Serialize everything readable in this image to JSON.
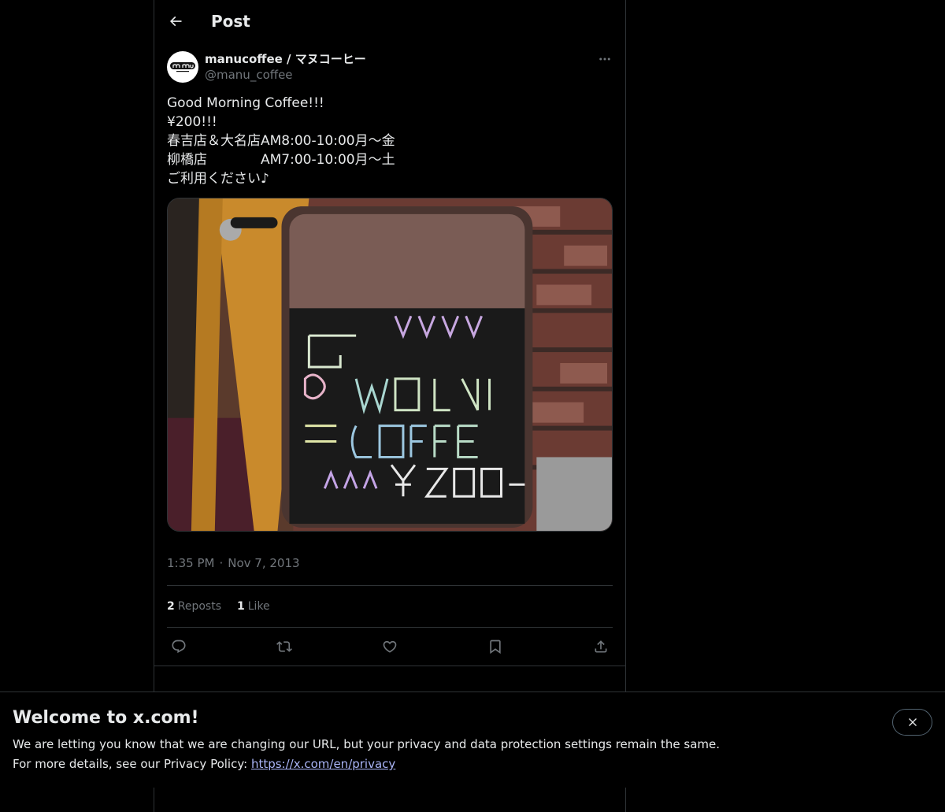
{
  "header": {
    "title": "Post",
    "back_icon": "arrow-left-icon"
  },
  "post": {
    "author": {
      "display_name": "manucoffee / マヌコーヒー",
      "handle": "@manu_coffee",
      "avatar_icon": "manucoffee-logo"
    },
    "text": "Good Morning Coffee!!!\n¥200!!!\n春吉店＆大名店AM8:00-10:00月〜金\n柳橋店　　　　AM7:00-10:00月〜土\nご利用ください♪",
    "timestamp": {
      "time": "1:35 PM",
      "separator": "·",
      "date": "Nov 7, 2013"
    },
    "stats": {
      "reposts_count": "2",
      "reposts_label": "Reposts",
      "likes_count": "1",
      "likes_label": "Like"
    },
    "actions": [
      "reply-icon",
      "repost-icon",
      "like-icon",
      "bookmark-icon",
      "share-icon"
    ]
  },
  "banner": {
    "title": "Welcome to x.com!",
    "line1": "We are letting you know that we are changing our URL, but your privacy and data protection settings remain the same.",
    "line2_prefix": "For more details, see our Privacy Policy: ",
    "link_text": "https://x.com/en/privacy",
    "close_icon": "close-icon"
  },
  "colors": {
    "background": "#000000",
    "text_primary": "#e7e9ea",
    "text_secondary": "#71767b",
    "border": "#2f3336",
    "link": "#a9b4f6"
  }
}
